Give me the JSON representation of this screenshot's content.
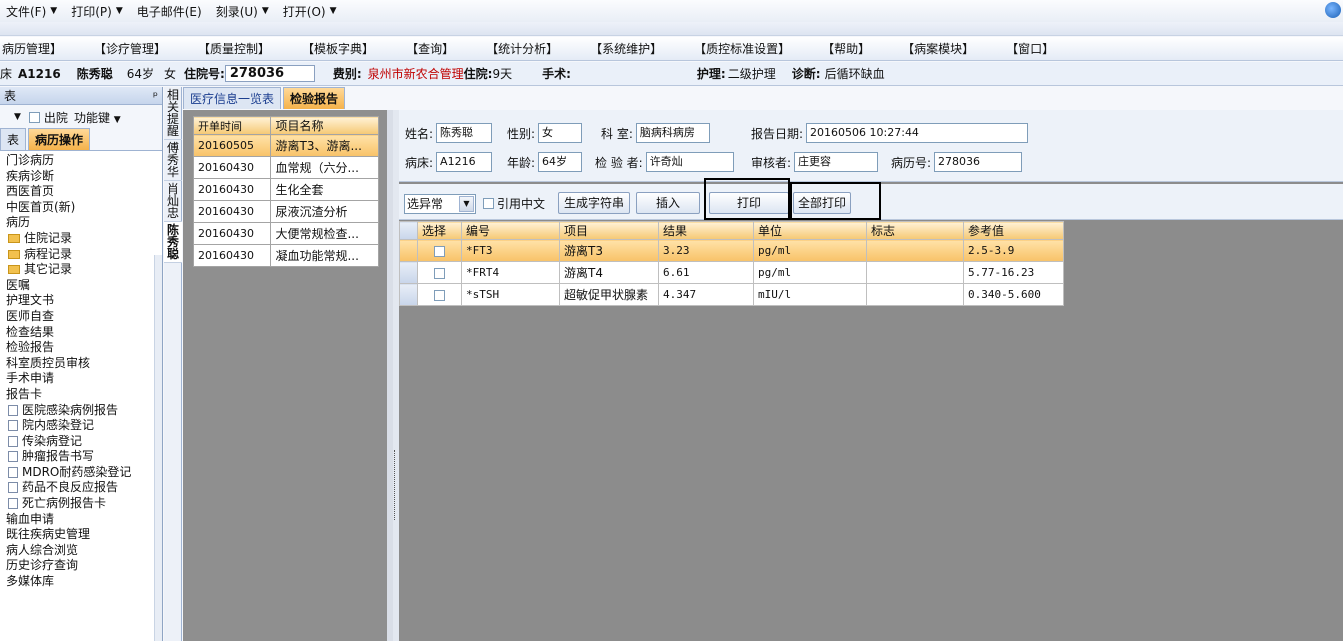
{
  "menubar": {
    "items": [
      "文件(F)",
      "打印(P)",
      "电子邮件(E)",
      "刻录(U)",
      "打开(O)"
    ],
    "dropdown_items": [
      true,
      true,
      false,
      true,
      true
    ]
  },
  "sysmenu": [
    "病历管理】",
    "【诊疗管理】",
    "【质量控制】",
    "【模板字典】",
    "【查询】",
    "【统计分析】",
    "【系统维护】",
    "【质控标准设置】",
    "【帮助】",
    "【病案模块】",
    "【窗口】"
  ],
  "patient": {
    "bed_prefix": "床",
    "bed": "A1216",
    "name": "陈秀聪",
    "age": "64岁",
    "sex": "女",
    "inpatient_label": "住院号:",
    "inpatient_no": "278036",
    "fee_label": "费别:",
    "fee_value": "泉州市新农合管理",
    "stay_label": "住院:",
    "stay_value": "9天",
    "surgery_label": "手术:",
    "surgery_value": "",
    "nursing_label": "护理:",
    "nursing_value": "二级护理",
    "diagnosis_label": "诊断:",
    "diagnosis_value": "后循环缺血"
  },
  "leftpanel": {
    "title": "表",
    "pin": "ᵖ",
    "discharge_label": "出院",
    "function_key_label": "功能键",
    "tabs": [
      "表",
      "病历操作"
    ],
    "tree": [
      {
        "label": "门诊病历",
        "level": 1,
        "icon": "none"
      },
      {
        "label": "疾病诊断",
        "level": 1,
        "icon": "none"
      },
      {
        "label": "西医首页",
        "level": 1,
        "icon": "none"
      },
      {
        "label": "中医首页(新)",
        "level": 1,
        "icon": "none"
      },
      {
        "label": "病历",
        "level": 1,
        "icon": "none"
      },
      {
        "label": "住院记录",
        "level": 2,
        "icon": "folder"
      },
      {
        "label": "病程记录",
        "level": 2,
        "icon": "folder"
      },
      {
        "label": "其它记录",
        "level": 2,
        "icon": "folder"
      },
      {
        "label": "医嘱",
        "level": 1,
        "icon": "none"
      },
      {
        "label": "护理文书",
        "level": 1,
        "icon": "none"
      },
      {
        "label": "医师自查",
        "level": 1,
        "icon": "none"
      },
      {
        "label": "检查结果",
        "level": 1,
        "icon": "none"
      },
      {
        "label": "检验报告",
        "level": 1,
        "icon": "none"
      },
      {
        "label": "科室质控员审核",
        "level": 1,
        "icon": "none"
      },
      {
        "label": "手术申请",
        "level": 1,
        "icon": "none"
      },
      {
        "label": "报告卡",
        "level": 1,
        "icon": "none"
      },
      {
        "label": "医院感染病例报告",
        "level": 2,
        "icon": "doc"
      },
      {
        "label": "院内感染登记",
        "level": 2,
        "icon": "doc"
      },
      {
        "label": "传染病登记",
        "level": 2,
        "icon": "doc"
      },
      {
        "label": "肿瘤报告书写",
        "level": 2,
        "icon": "doc"
      },
      {
        "label": "MDRO耐药感染登记",
        "level": 2,
        "icon": "doc"
      },
      {
        "label": "药品不良反应报告",
        "level": 2,
        "icon": "doc"
      },
      {
        "label": "死亡病例报告卡",
        "level": 2,
        "icon": "doc"
      },
      {
        "label": "输血申请",
        "level": 1,
        "icon": "none"
      },
      {
        "label": "既往疾病史管理",
        "level": 1,
        "icon": "none"
      },
      {
        "label": "病人综合浏览",
        "level": 1,
        "icon": "none"
      },
      {
        "label": "历史诊疗查询",
        "level": 1,
        "icon": "none"
      },
      {
        "label": "多媒体库",
        "level": 1,
        "icon": "none"
      }
    ]
  },
  "vtabs": [
    "相关提醒",
    "傅秀华",
    "肖灿忠",
    "陈秀聪"
  ],
  "innertabs": [
    "医疗信息一览表",
    "检验报告"
  ],
  "orders": {
    "headers": [
      "开单时间",
      "项目名称"
    ],
    "rows": [
      [
        "20160505",
        "游离T3、游离..."
      ],
      [
        "20160430",
        "血常规（六分..."
      ],
      [
        "20160430",
        "生化全套"
      ],
      [
        "20160430",
        "尿液沉渣分析"
      ],
      [
        "20160430",
        "大便常规检查..."
      ],
      [
        "20160430",
        "凝血功能常规..."
      ]
    ]
  },
  "report": {
    "name_label": "姓名:",
    "name_value": "陈秀聪",
    "sex_label": "性别:",
    "sex_value": "女",
    "dept_label": "科 室:",
    "dept_value": "脑病科病房",
    "date_label": "报告日期:",
    "date_value": "20160506 10:27:44",
    "bed_label": "病床:",
    "bed_value": "A1216",
    "age_label": "年龄:",
    "age_value": "64岁",
    "tester_label": "检 验 者:",
    "tester_value": "许奇灿",
    "reviewer_label": "审核者:",
    "reviewer_value": "庄更容",
    "record_label": "病历号:",
    "record_value": "278036"
  },
  "toolbar": {
    "filter_value": "选异常",
    "cite_label": "引用中文",
    "gen_label": "生成字符串",
    "insert_label": "插入",
    "print_label": "打印",
    "print_all_label": "全部打印"
  },
  "results": {
    "headers": [
      "选择",
      "编号",
      "项目",
      "结果",
      "单位",
      "标志",
      "参考值"
    ],
    "rows": [
      [
        "*FT3",
        "游离T3",
        "3.23",
        "pg/ml",
        "",
        "2.5-3.9"
      ],
      [
        "*FRT4",
        "游离T4",
        "6.61",
        "pg/ml",
        "",
        "5.77-16.23"
      ],
      [
        "*sTSH",
        "超敏促甲状腺素",
        "4.347",
        "mIU/l",
        "",
        "0.340-5.600"
      ]
    ]
  }
}
